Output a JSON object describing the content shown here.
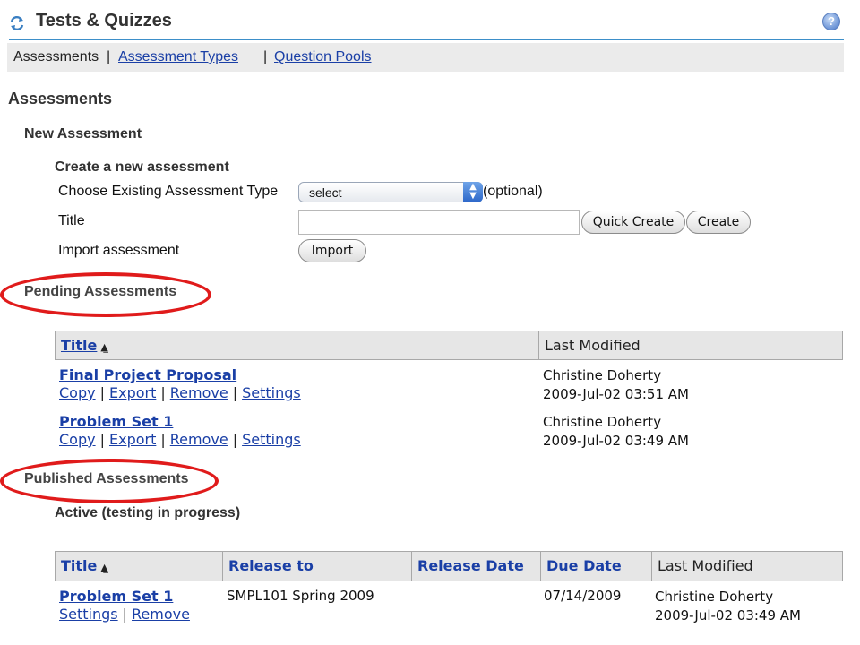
{
  "header": {
    "title": "Tests & Quizzes",
    "help_glyph": "?"
  },
  "nav": {
    "current": "Assessments",
    "sep": "|",
    "types_link": "Assessment Types",
    "pools_link": "Question Pools"
  },
  "assessments_heading": "Assessments",
  "new_assessment": {
    "heading": "New Assessment",
    "create_heading": "Create a new assessment",
    "type_label": "Choose Existing Assessment Type",
    "type_select_value": "select",
    "optional_label": "(optional)",
    "title_label": "Title",
    "title_value": "",
    "quick_create_label": "Quick Create",
    "create_label": "Create",
    "import_label": "Import assessment",
    "import_button": "Import"
  },
  "pending": {
    "heading": "Pending Assessments",
    "columns": [
      "Title",
      "Last Modified"
    ],
    "actions": [
      "Copy",
      "Export",
      "Remove",
      "Settings"
    ],
    "rows": [
      {
        "title": "Final Project Proposal",
        "modified_by": "Christine Doherty",
        "modified_at": "2009-Jul-02 03:51 AM"
      },
      {
        "title": "Problem Set 1",
        "modified_by": "Christine Doherty",
        "modified_at": "2009-Jul-02 03:49 AM"
      }
    ]
  },
  "published": {
    "heading": "Published Assessments",
    "active_heading": "Active (testing in progress)",
    "columns": [
      "Title",
      "Release to",
      "Release Date",
      "Due Date",
      "Last Modified"
    ],
    "actions": [
      "Settings",
      "Remove"
    ],
    "rows": [
      {
        "title": "Problem Set 1",
        "release_to": "SMPL101 Spring 2009",
        "release_date": "",
        "due_date": "07/14/2009",
        "modified_by": "Christine Doherty",
        "modified_at": "2009-Jul-02 03:49 AM"
      }
    ]
  },
  "colors": {
    "link": "#1a3fa6",
    "rule": "#3d8fc9",
    "highlight_oval": "#e01b1b",
    "table_header": "#e6e6e6"
  },
  "icons": {
    "refresh": "refresh-icon",
    "help": "help-icon",
    "sort": "sort-ascending-icon",
    "select_arrows": "updown-arrows-icon"
  }
}
